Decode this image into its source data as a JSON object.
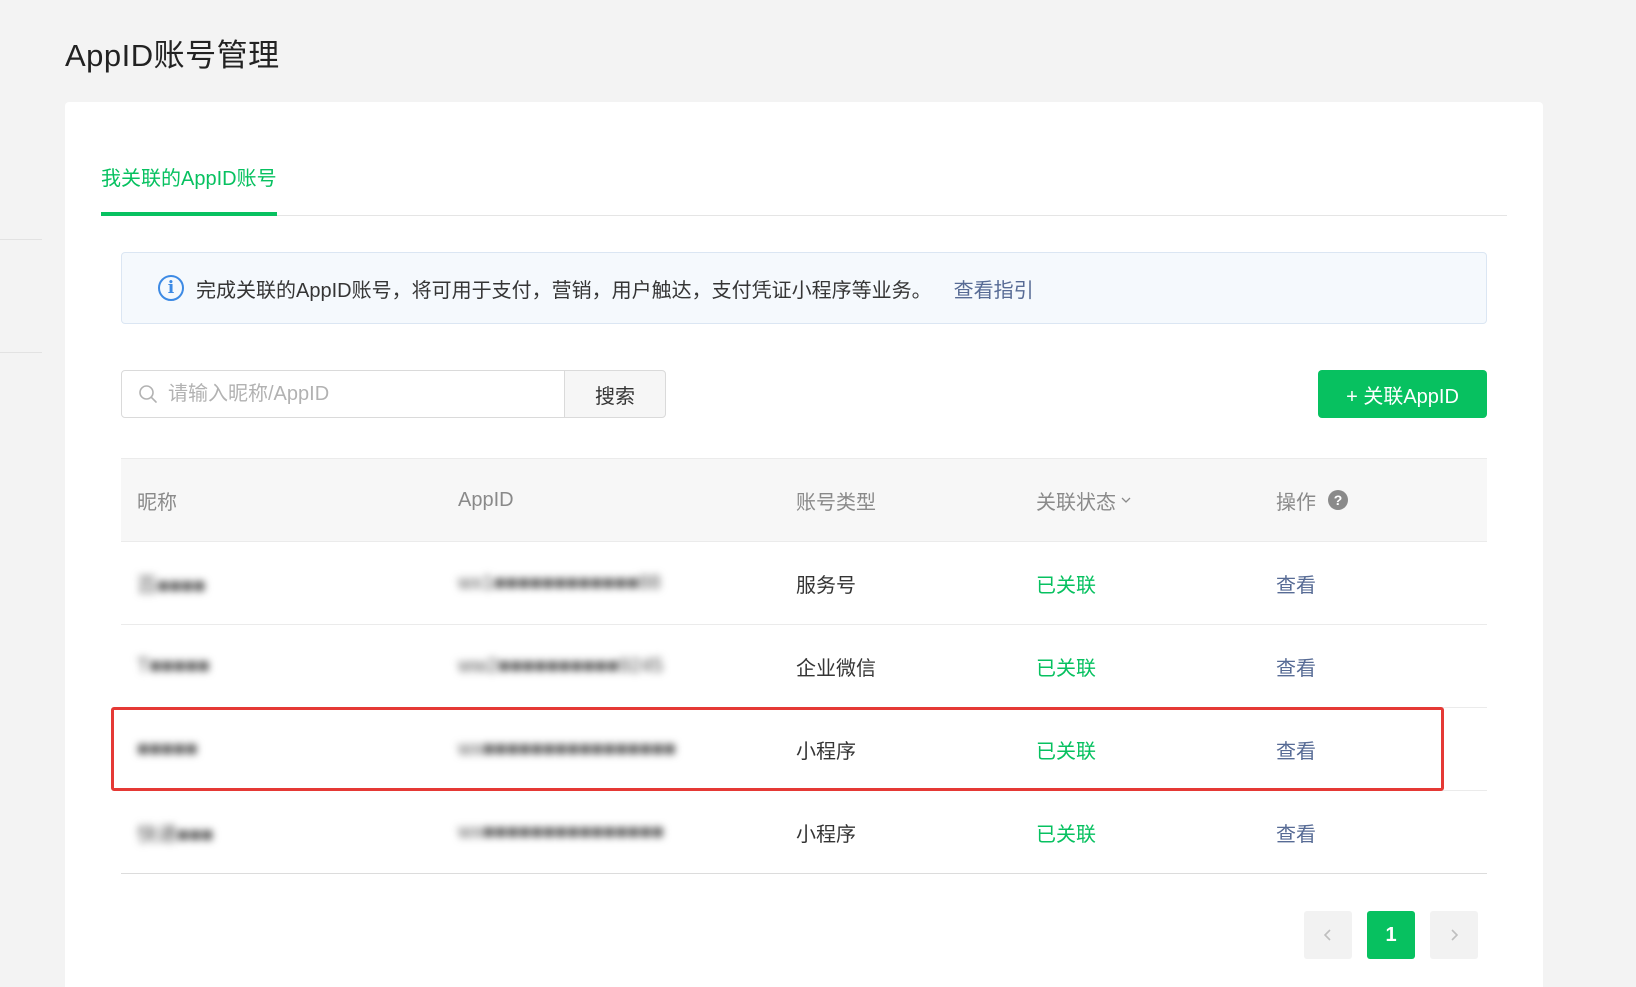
{
  "page": {
    "title": "AppID账号管理"
  },
  "tabs": [
    {
      "label": "我关联的AppID账号",
      "active": true
    }
  ],
  "notice": {
    "icon": "info-icon",
    "text": "完成关联的AppID账号，将可用于支付，营销，用户触达，支付凭证小程序等业务。",
    "link": "查看指引"
  },
  "search": {
    "placeholder": "请输入昵称/AppID",
    "value": "",
    "button": "搜索"
  },
  "add_button": "+ 关联AppID",
  "table": {
    "headers": {
      "nickname": "昵称",
      "appid": "AppID",
      "type": "账号类型",
      "status": "关联状态",
      "action": "操作"
    },
    "rows": [
      {
        "nickname": "百■■■■",
        "appid": "wx1■■■■■■■■■■■■88",
        "type": "服务号",
        "status": "已关联",
        "action": "查看"
      },
      {
        "nickname": "T■■■■■",
        "appid": "ww2■■■■■■■■■■9245",
        "type": "企业微信",
        "status": "已关联",
        "action": "查看"
      },
      {
        "nickname": "■■■■■",
        "appid": "wx■■■■■■■■■■■■■■■■",
        "type": "小程序",
        "status": "已关联",
        "action": "查看"
      },
      {
        "nickname": "快递■■■",
        "appid": "wx■■■■■■■■■■■■■■■",
        "type": "小程序",
        "status": "已关联",
        "action": "查看"
      }
    ]
  },
  "pagination": {
    "current": "1",
    "prev_icon": "chevron-left-icon",
    "next_icon": "chevron-right-icon"
  },
  "colors": {
    "accent": "#07c160",
    "link": "#576b95",
    "highlight": "#e53935"
  }
}
